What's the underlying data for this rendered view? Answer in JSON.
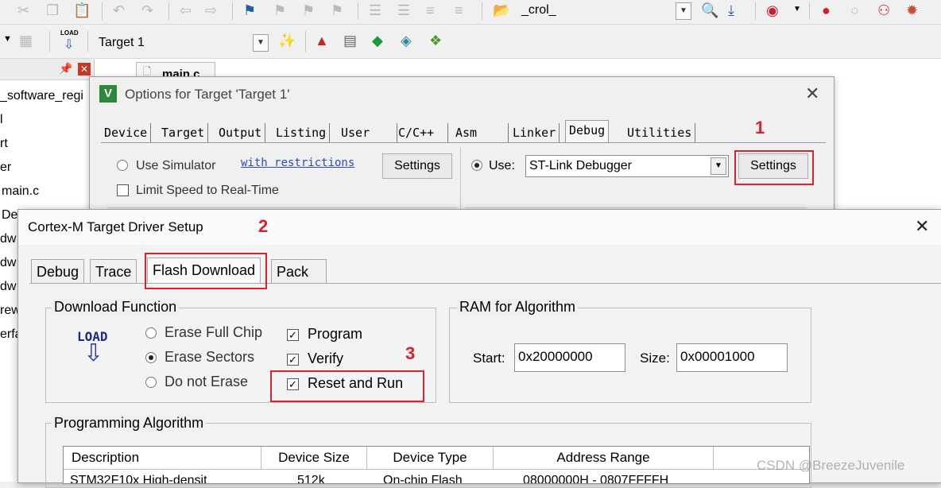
{
  "toolbar": {
    "find_text": "_crol_",
    "target_name": "Target 1",
    "load_icon_label": "LOAD"
  },
  "left_panel": {
    "items": [
      "_software_regi",
      "l",
      "rt",
      "er",
      "main.c",
      "De",
      "dw",
      "dw",
      "dw",
      "rew",
      "erfa"
    ]
  },
  "editor": {
    "tab_label": "main.c"
  },
  "options_dialog": {
    "title": "Options for Target 'Target 1'",
    "tabs": [
      "Device",
      "Target",
      "Output",
      "Listing",
      "User",
      "C/C++",
      "Asm",
      "Linker",
      "Debug",
      "Utilities"
    ],
    "use_simulator_label": "Use Simulator",
    "restrictions_link": "with restrictions",
    "settings_label": "Settings",
    "limit_speed_label": "Limit Speed to Real-Time",
    "use_label": "Use:",
    "debugger_value": "ST-Link Debugger",
    "settings_right_label": "Settings"
  },
  "driver_dialog": {
    "title": "Cortex-M Target Driver Setup",
    "tabs": [
      "Debug",
      "Trace",
      "Flash Download",
      "Pack"
    ],
    "download_function": {
      "label": "Download Function",
      "icon_text": "LOAD",
      "erase_full": "Erase Full Chip",
      "erase_sectors": "Erase Sectors",
      "do_not_erase": "Do not Erase",
      "program": "Program",
      "verify": "Verify",
      "reset_run": "Reset and Run"
    },
    "ram": {
      "label": "RAM for Algorithm",
      "start_label": "Start:",
      "start_value": "0x20000000",
      "size_label": "Size:",
      "size_value": "0x00001000"
    },
    "programming": {
      "label": "Programming Algorithm",
      "columns": [
        "Description",
        "Device Size",
        "Device Type",
        "Address Range"
      ],
      "row": [
        "STM32F10x High-densit",
        "512k",
        "On-chip Flash",
        "08000000H - 0807FFFFH"
      ]
    }
  },
  "annotations": [
    "1",
    "2",
    "3"
  ],
  "watermark": "CSDN @BreezeJuvenile"
}
